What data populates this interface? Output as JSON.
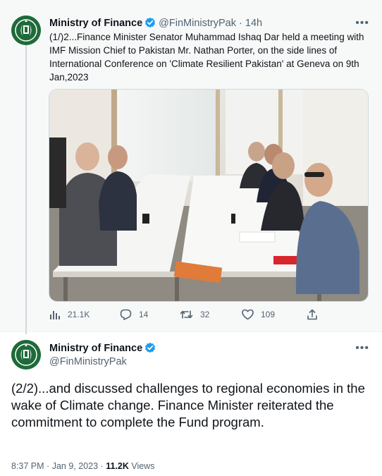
{
  "tweet1": {
    "display_name": "Ministry of Finance",
    "handle": "@FinMinistryPak",
    "separator": "·",
    "time_ago": "14h",
    "more": "•••",
    "text": "(1/)2...Finance Minister Senator Muhammad Ishaq Dar held a meeting with IMF Mission Chief to Pakistan Mr. Nathan Porter, on the side lines of International Conference on 'Climate Resilient Pakistan' at Geneva on 9th Jan,2023",
    "actions": {
      "views": "21.1K",
      "replies": "14",
      "retweets": "32",
      "likes": "109"
    }
  },
  "tweet2": {
    "display_name": "Ministry of Finance",
    "handle": "@FinMinistryPak",
    "more": "•••",
    "text": "(2/2)...and discussed challenges to regional economies in the wake of Climate change. Finance Minister reiterated the commitment to complete the Fund program.",
    "time": "8:37 PM",
    "date": "Jan 9, 2023",
    "dot": "·",
    "views_count": "11.2K",
    "views_label": "Views"
  },
  "colors": {
    "verified": "#1d9bf0",
    "secondary_text": "#536471",
    "avatar_green": "#1e6b3a"
  },
  "icons": [
    "verified-badge-icon",
    "more-icon",
    "views-icon",
    "reply-icon",
    "retweet-icon",
    "like-icon",
    "share-icon"
  ]
}
